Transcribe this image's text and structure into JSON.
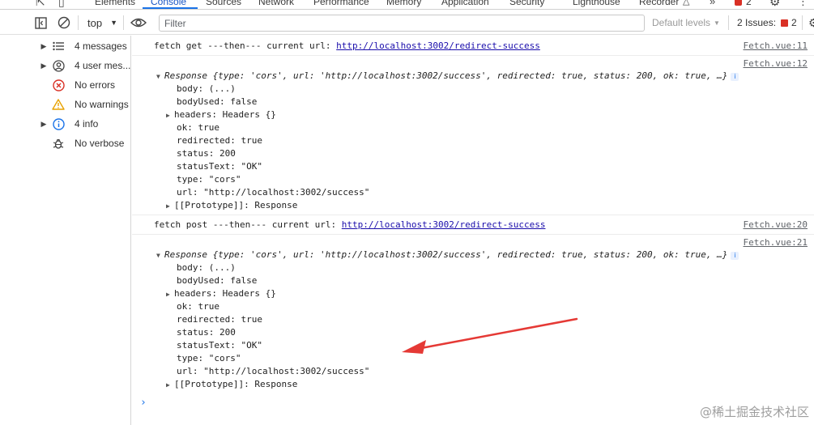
{
  "tabs": {
    "elements": "Elements",
    "console": "Console",
    "sources": "Sources",
    "network": "Network",
    "performance": "Performance",
    "memory": "Memory",
    "application": "Application",
    "security": "Security",
    "lighthouse": "Lighthouse",
    "recorder": "Recorder",
    "error_count": "2"
  },
  "toolbar": {
    "context": "top",
    "filter_placeholder": "Filter",
    "levels": "Default levels",
    "issues_label": "2 Issues:",
    "issues_count": "2"
  },
  "sidebar": {
    "items": [
      {
        "label": "4 messages",
        "icon": "list-icon"
      },
      {
        "label": "4 user mes...",
        "icon": "user-icon"
      },
      {
        "label": "No errors",
        "icon": "error-icon"
      },
      {
        "label": "No warnings",
        "icon": "warning-icon"
      },
      {
        "label": "4 info",
        "icon": "info-icon"
      },
      {
        "label": "No verbose",
        "icon": "bug-icon"
      }
    ]
  },
  "log1": {
    "text": "fetch get ---then--- current url: ",
    "url": "http://localhost:3002/redirect-success",
    "source": "Fetch.vue:11"
  },
  "obj1": {
    "source": "Fetch.vue:12",
    "summary_head": "Response ",
    "summary": "{type: 'cors', url: 'http://localhost:3002/success', redirected: true, status: 200, ok: true, …}",
    "props": [
      "body: (...)",
      "bodyUsed: false",
      "headers: Headers {}",
      "ok: true",
      "redirected: true",
      "status: 200",
      "statusText: \"OK\"",
      "type: \"cors\"",
      "url: \"http://localhost:3002/success\"",
      "[[Prototype]]: Response"
    ]
  },
  "log2": {
    "text": "fetch post ---then--- current url: ",
    "url": "http://localhost:3002/redirect-success",
    "source": "Fetch.vue:20"
  },
  "obj2": {
    "source": "Fetch.vue:21",
    "summary_head": "Response ",
    "summary": "{type: 'cors', url: 'http://localhost:3002/success', redirected: true, status: 200, ok: true, …}",
    "props": [
      "body: (...)",
      "bodyUsed: false",
      "headers: Headers {}",
      "ok: true",
      "redirected: true",
      "status: 200",
      "statusText: \"OK\"",
      "type: \"cors\"",
      "url: \"http://localhost:3002/success\"",
      "[[Prototype]]: Response"
    ]
  },
  "prompt": "›",
  "watermark": "@稀土掘金技术社区",
  "colors": {
    "accent": "#1a73e8",
    "annotation_arrow": "#e53935",
    "error_badge": "#d93025"
  }
}
